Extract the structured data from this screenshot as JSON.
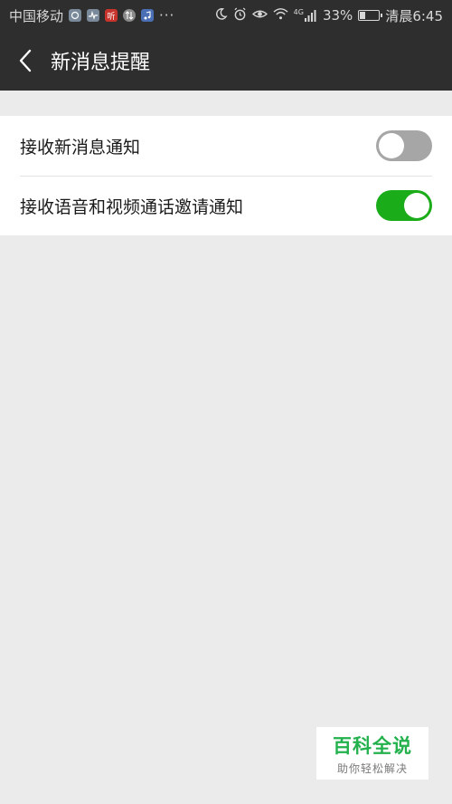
{
  "status_bar": {
    "carrier": "中国移动",
    "icons": [
      "network-icon",
      "activity-icon",
      "listen-app-icon",
      "data-transfer-icon",
      "music-icon"
    ],
    "listen_icon_text": "听",
    "more": "···",
    "right_icons": [
      "moon-icon",
      "alarm-icon",
      "eye-icon",
      "wifi-icon",
      "signal-icon"
    ],
    "network_type": "4G",
    "battery_percent": "33%",
    "battery_level": 0.33,
    "time": "清晨6:45"
  },
  "header": {
    "title": "新消息提醒",
    "background": "#2e2e2e"
  },
  "settings": [
    {
      "label": "接收新消息通知",
      "enabled": false
    },
    {
      "label": "接收语音和视频通话邀请通知",
      "enabled": true
    }
  ],
  "colors": {
    "toggle_on": "#1aad19",
    "toggle_off": "#a6a6a6",
    "page_background": "#ebebeb"
  },
  "watermark": {
    "brand": "百科全说",
    "tagline": "助你轻松解决"
  }
}
